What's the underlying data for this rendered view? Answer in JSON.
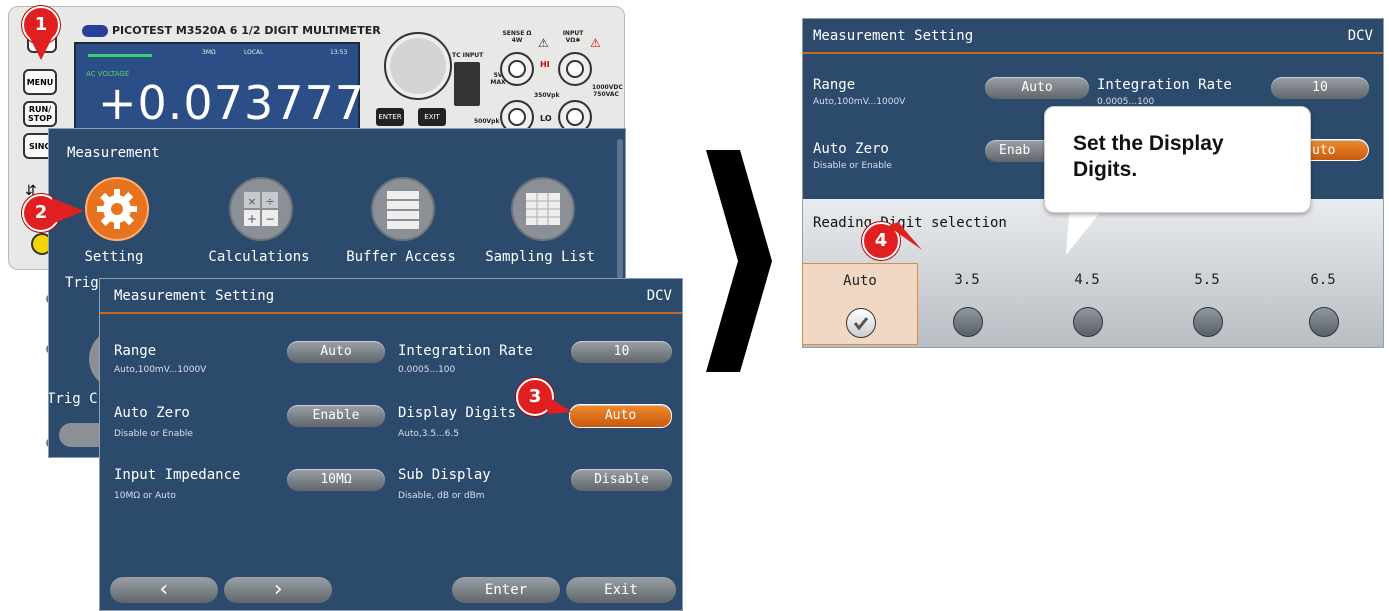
{
  "panel": {
    "brand": "PICOTEST  M3520A  6 1/2 DIGIT MULTIMETER",
    "buttons": [
      "MENU",
      "RUN/ STOP",
      "SING"
    ],
    "lcd": {
      "mode": "AC VOLTAGE",
      "value": "+0.073777",
      "remote": "LOCAL",
      "time": "13:53",
      "range": "3MΩ"
    },
    "keys": [
      "ENTER",
      "EXIT"
    ],
    "labels": {
      "tc": "TC INPUT",
      "sense": "SENSE Ω 4W",
      "input": "INPUT VΩ✱",
      "hi": "HI",
      "lo": "LO",
      "v5": "5V MAX",
      "v350": "350Vpk",
      "v500": "500Vpk",
      "v1000": "1000VDC 750VAC"
    }
  },
  "measurement": {
    "title": "Measurement",
    "items": [
      "Setting",
      "Calculations",
      "Buffer Access",
      "Sampling List"
    ],
    "behind": [
      "Trig",
      "Trig C"
    ]
  },
  "setting_left": {
    "title": "Measurement Setting",
    "function": "DCV",
    "rows": [
      {
        "label": "Range",
        "sub": "Auto,100mV...1000V",
        "value": "Auto"
      },
      {
        "label": "Integration Rate",
        "sub": "0.0005...100",
        "value": "10"
      },
      {
        "label": "Auto Zero",
        "sub": "Disable or Enable",
        "value": "Enable"
      },
      {
        "label": "Display Digits",
        "sub": "Auto,3.5...6.5",
        "value": "Auto"
      },
      {
        "label": "Input Impedance",
        "sub": "10MΩ or Auto",
        "value": "10MΩ"
      },
      {
        "label": "Sub Display",
        "sub": "Disable, dB or dBm",
        "value": "Disable"
      }
    ],
    "nav": {
      "prev": "‹",
      "next": "›",
      "enter": "Enter",
      "exit": "Exit"
    }
  },
  "setting_right": {
    "title": "Measurement Setting",
    "function": "DCV",
    "range_label": "Range",
    "range_sub": "Auto,100mV...1000V",
    "range_value": "Auto",
    "rate_label": "Integration Rate",
    "rate_sub": "0.0005...100",
    "rate_value": "10",
    "zero_label": "Auto Zero",
    "zero_sub": "Disable or Enable",
    "zero_value": "Enab",
    "digits_value": "uto",
    "selection_title": "Reading Digit selection",
    "options": [
      "Auto",
      "3.5",
      "4.5",
      "5.5",
      "6.5"
    ],
    "selected": "Auto"
  },
  "callout": "Set the Display Digits.",
  "steps": [
    "1",
    "2",
    "3",
    "4"
  ],
  "colors": {
    "screen_bg": "#2c4b6c",
    "accent": "#e8731f",
    "marker": "#e02020"
  }
}
